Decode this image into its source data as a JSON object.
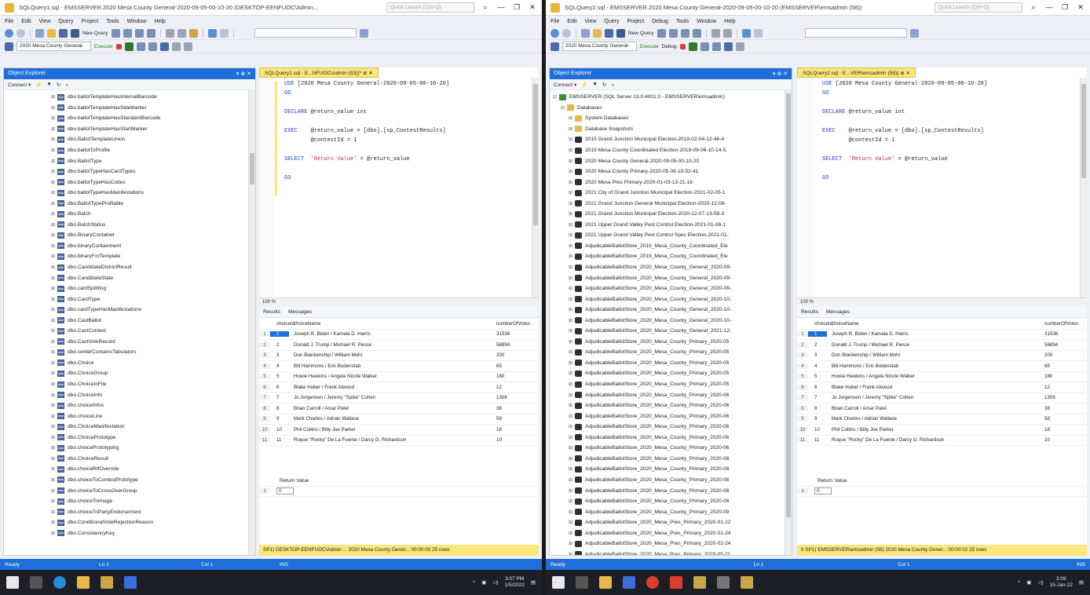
{
  "left": {
    "window_title": "SQLQuery1.sql - EMSSERVER.2020 Mesa County General-2020-09-05-00-10-20 (DESKTOP-EENFUOC\\Admin...",
    "quick_launch": "Quick Launch (Ctrl+Q)",
    "menu": [
      "File",
      "Edit",
      "View",
      "Query",
      "Project",
      "Tools",
      "Window",
      "Help"
    ],
    "toolbar": {
      "new_query": "New Query",
      "db_combo": "2020 Mesa County General-",
      "execute": "Execute"
    },
    "object_explorer": {
      "title": "Object Explorer",
      "pin": "▾ ⊕ ✕",
      "connect": "Connect ▾",
      "items": [
        "dbo.ballotTemplateHasInternalBarcode",
        "dbo.ballotTemplateHasSideMarker",
        "dbo.ballotTemplateHasStandardBarcode",
        "dbo.ballotTemplateHasStartMarker",
        "dbo.BallotTemplateUnion",
        "dbo.ballotToProfile",
        "dbo.BallotType",
        "dbo.ballotTypeHasCardTypes",
        "dbo.ballotTypeHasCodes",
        "dbo.ballotTypeHasManifestations",
        "dbo.BallotTypeProfilable",
        "dbo.Batch",
        "dbo.BatchStatus",
        "dbo.BinaryContainer",
        "dbo.binaryContainment",
        "dbo.binaryForTemplate",
        "dbo.CandidateDistrictResult",
        "dbo.CandidateState",
        "dbo.cardSplitting",
        "dbo.CardType",
        "dbo.cardTypeHasManifestations",
        "dbo.CastBallot",
        "dbo.CastContest",
        "dbo.CastVoteRecord",
        "dbo.centerContainsTabulators",
        "dbo.Choice",
        "dbo.ChoiceGroup",
        "dbo.ChoiceInFile",
        "dbo.ChoiceInfo",
        "dbo.choiceInfos",
        "dbo.choiceLine",
        "dbo.ChoiceManifestation",
        "dbo.ChoicePrototype",
        "dbo.choicePrototyping",
        "dbo.ChoiceResult",
        "dbo.choiceRtfOverride",
        "dbo.choiceToContestPrototype",
        "dbo.choiceToCrossOverGroup",
        "dbo.choiceToImage",
        "dbo.choiceToPartyEndorsement",
        "dbo.ConditionalVoteRejectionReason",
        "dbo.ConsistencyKey"
      ]
    },
    "doc_tab": "SQLQuery1.sql - E...NFUOC\\Admin (53))*  ⊕  ✕",
    "zoom": "100 %",
    "status_query": "SP1)   DESKTOP-EENFUOC\\Admin ...   2020 Mesa County Gener...   00:00:00   25 rows",
    "statusbar": {
      "ready": "Ready",
      "ln": "Ln 1",
      "col": "Col 1",
      "ins": "INS"
    },
    "clock": {
      "time": "3:07 PM",
      "date": "1/5/2022"
    }
  },
  "right": {
    "window_title": "SQLQuery2.sql - EMSSERVER.2020 Mesa County General-2020-09-05-00-10-20 (EMSSERVER\\emsadmin (58))",
    "quick_launch": "Quick Launch (Ctrl+Q)",
    "menu": [
      "File",
      "Edit",
      "View",
      "Query",
      "Project",
      "Debug",
      "Tools",
      "Window",
      "Help"
    ],
    "toolbar": {
      "new_query": "New Query",
      "db_combo": "2020 Mesa County General-",
      "execute": "Execute",
      "debug": "Debug"
    },
    "object_explorer": {
      "title": "Object Explorer",
      "pin": "▾ ⊕ ✕",
      "connect": "Connect ▾",
      "server": "EMSSERVER (SQL Server 13.0.4001.0 - EMSSERVER\\emsadmin)",
      "databases": "Databases",
      "system_dbs": "System Databases",
      "snapshots": "Database Snapshots",
      "items": [
        "2015 Grand Junction Municipal Election-2019-02-04-12-46-4",
        "2019 Mesa County Coordinated Election-2019-09-06-10-14-5",
        "2020 Mesa County General-2020-09-05-00-10-20",
        "2020 Mesa County Primary-2020-05-06-10-52-41",
        "2020 Mesa Pres Primary-2020-01-03-13-21-16",
        "2021 City of Grand Junction Municipal Election-2021-02-05-1",
        "2021 Grand Junction General Municipal Election-2020-12-08-",
        "2021 Grand Junction Municipal Election-2020-12-07-13-58-3",
        "2021 Upper Grand Valley Pest Control Election-2021-01-08-1",
        "2021 Upper Grand Valley Pest Control Spec Election-2021-01-",
        "AdjudicableBallotStore_2019_Mesa_County_Coordinated_Ele",
        "AdjudicableBallotStore_2019_Mesa_County_Coordinated_Ele",
        "AdjudicableBallotStore_2020_Mesa_County_General_2020-09-",
        "AdjudicableBallotStore_2020_Mesa_County_General_2020-09-",
        "AdjudicableBallotStore_2020_Mesa_County_General_2020-09-",
        "AdjudicableBallotStore_2020_Mesa_County_General_2020-10-",
        "AdjudicableBallotStore_2020_Mesa_County_General_2020-10-",
        "AdjudicableBallotStore_2020_Mesa_County_General_2020-10-",
        "AdjudicableBallotStore_2020_Mesa_County_General_2021-12-",
        "AdjudicableBallotStore_2020_Mesa_County_Primary_2020-05",
        "AdjudicableBallotStore_2020_Mesa_County_Primary_2020-05",
        "AdjudicableBallotStore_2020_Mesa_County_Primary_2020-05",
        "AdjudicableBallotStore_2020_Mesa_County_Primary_2020-05",
        "AdjudicableBallotStore_2020_Mesa_County_Primary_2020-05",
        "AdjudicableBallotStore_2020_Mesa_County_Primary_2020-06",
        "AdjudicableBallotStore_2020_Mesa_County_Primary_2020-06",
        "AdjudicableBallotStore_2020_Mesa_County_Primary_2020-06",
        "AdjudicableBallotStore_2020_Mesa_County_Primary_2020-06",
        "AdjudicableBallotStore_2020_Mesa_County_Primary_2020-06",
        "AdjudicableBallotStore_2020_Mesa_County_Primary_2020-06",
        "AdjudicableBallotStore_2020_Mesa_County_Primary_2020-08",
        "AdjudicableBallotStore_2020_Mesa_County_Primary_2020-08",
        "AdjudicableBallotStore_2020_Mesa_County_Primary_2020-08",
        "AdjudicableBallotStore_2020_Mesa_County_Primary_2020-08",
        "AdjudicableBallotStore_2020_Mesa_County_Primary_2020-08",
        "AdjudicableBallotStore_2020_Mesa_County_Primary_2020-09",
        "AdjudicableBallotStore_2020_Mesa_Pres_Primary_2020-01-22",
        "AdjudicableBallotStore_2020_Mesa_Pres_Primary_2020-01-24",
        "AdjudicableBallotStore_2020_Mesa_Pres_Primary_2020-02-24",
        "AdjudicableBallotStore_2020_Mesa_Pres_Primary_2020-05-21"
      ]
    },
    "doc_tab": "SQLQuery2.sql - E...VER\\emsadmin (58))  ⊕  ✕",
    "zoom": "100 %",
    "status_query": "0 SP1)   EMSSERVER\\emsadmin (58)   2020 Mesa County Gener...   00:00:02   25 rows",
    "statusbar": {
      "ready": "Ready",
      "ln": "Ln 1",
      "col": "Col 1",
      "ins": "INS"
    },
    "clock": {
      "time": "3:09",
      "date": "15-Jan-22"
    }
  },
  "query": {
    "line1_kw": "USE",
    "line1_rest": " [2020 Mesa County General-2020-09-05-00-10-20]",
    "line2": "GO",
    "line3_kw": "DECLARE",
    "line3_rest": " @return_value int",
    "line4_kw": "EXEC",
    "line4_rest": "    @return_value = [dbo].[sp_ContestResults]",
    "line5": "        @contestId = 1",
    "line6_kw": "SELECT",
    "line6_str": "  'Return Value'",
    "line6_rest": " = @return_value",
    "line7": "GO"
  },
  "results": {
    "tab_results": "Results",
    "tab_messages": "Messages",
    "col_id": "choiceId",
    "col_name": "choiceName",
    "col_votes": "numberOfVotes",
    "rows": [
      {
        "n": "1",
        "id": "1",
        "name": "Joseph R. Biden / Kamala D. Harris",
        "votes": "31536"
      },
      {
        "n": "2",
        "id": "2",
        "name": "Donald J. Trump / Michael R. Pence",
        "votes": "56894"
      },
      {
        "n": "3",
        "id": "3",
        "name": "Don Blankenship / William Mohr",
        "votes": "200"
      },
      {
        "n": "4",
        "id": "4",
        "name": "Bill Hammons / Eric Bodenstab",
        "votes": "65"
      },
      {
        "n": "5",
        "id": "5",
        "name": "Howie Hawkins / Angela Nicole Walker",
        "votes": "180"
      },
      {
        "n": "6",
        "id": "6",
        "name": "Blake Huber / Frank Atwood",
        "votes": "12"
      },
      {
        "n": "7",
        "id": "7",
        "name": "Jo Jorgensen / Jeremy \"Spike\" Cohen",
        "votes": "1306"
      },
      {
        "n": "8",
        "id": "8",
        "name": "Brian Carroll / Amar Patel",
        "votes": "38"
      },
      {
        "n": "9",
        "id": "9",
        "name": "Mark Charles / Adrian Wallace",
        "votes": "58"
      },
      {
        "n": "10",
        "id": "10",
        "name": "Phil Collins / Billy Joe Parker",
        "votes": "18"
      },
      {
        "n": "11",
        "id": "11",
        "name": "Roque \"Rocky\" De La Fuente / Darcy G. Richardson",
        "votes": "10"
      }
    ],
    "return_label": "Return Value",
    "return_row": "1",
    "return_value": "0"
  }
}
